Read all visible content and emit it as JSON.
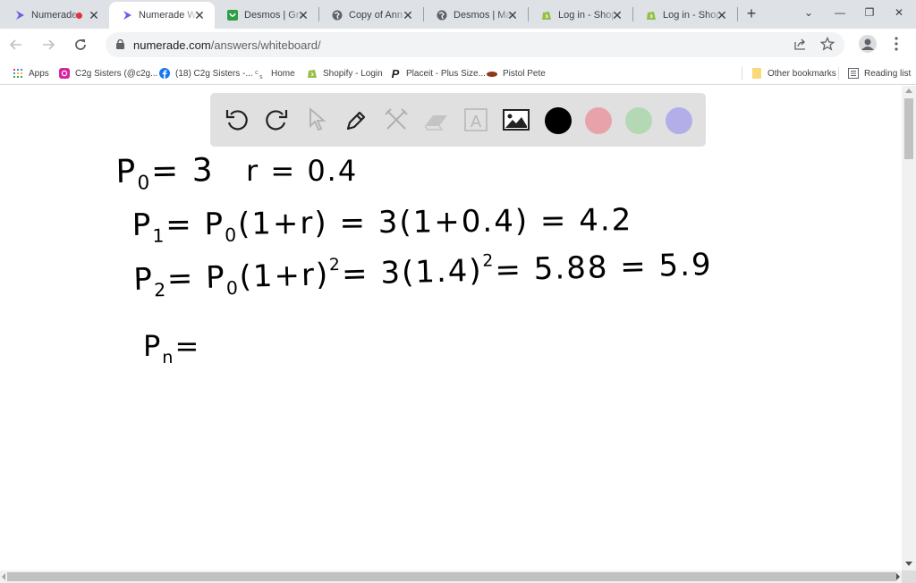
{
  "browser": {
    "tabs": [
      {
        "title": "Numerade",
        "favicon": "numerade-logo",
        "recording": true,
        "active": false
      },
      {
        "title": "Numerade Whiteboard",
        "favicon": "numerade-logo",
        "active": true
      },
      {
        "title": "Desmos | Graphing Calculator",
        "favicon": "desmos-logo",
        "active": false
      },
      {
        "title": "Copy of Ann X",
        "favicon": "globe-icon",
        "active": false
      },
      {
        "title": "Desmos | Matrix",
        "favicon": "globe-icon",
        "active": false
      },
      {
        "title": "Log in - Shopify",
        "favicon": "shopify-logo",
        "active": false
      },
      {
        "title": "Log in - Shopify",
        "favicon": "shopify-logo",
        "active": false
      }
    ],
    "new_tab_icon": "+",
    "window_controls": {
      "dropdown": "⌄",
      "minimize": "—",
      "restore": "❐",
      "close": "✕"
    },
    "address": {
      "domain": "numerade.com",
      "path": "/answers/whiteboard/"
    },
    "bookmarks": [
      {
        "label": "Apps",
        "icon": "apps-grid-icon"
      },
      {
        "label": "C2g Sisters (@c2g...",
        "icon": "instagram-icon"
      },
      {
        "label": "(18) C2g Sisters -...",
        "icon": "facebook-icon"
      },
      {
        "label": "Home",
        "icon": "home-link-icon"
      },
      {
        "label": "Shopify - Login",
        "icon": "shopify-icon"
      },
      {
        "label": "Placeit - Plus Size...",
        "icon": "placeit-icon"
      },
      {
        "label": "Pistol Pete",
        "icon": "pistol-pete-icon"
      }
    ],
    "other_bookmarks": "Other bookmarks",
    "reading_list": "Reading list"
  },
  "whiteboard": {
    "tools": [
      {
        "name": "undo",
        "enabled": true
      },
      {
        "name": "redo",
        "enabled": true
      },
      {
        "name": "select",
        "enabled": false
      },
      {
        "name": "pen",
        "enabled": true,
        "selected": true
      },
      {
        "name": "shapes",
        "enabled": false
      },
      {
        "name": "eraser",
        "enabled": false
      },
      {
        "name": "text",
        "enabled": false,
        "glyph": "A"
      },
      {
        "name": "image",
        "enabled": true
      }
    ],
    "colors": [
      "#000000",
      "#e8a3aa",
      "#b3d8b3",
      "#b3aee8"
    ],
    "handwriting": {
      "line1_a": {
        "base": "P",
        "sub": "0",
        "rest": "= 3"
      },
      "line1_b": "r = 0.4",
      "line2": {
        "base": "P",
        "sub": "1",
        "rest": "= P",
        "sub2": "0",
        "rest2": "(1+r) = 3(1+0.4) = 4.2"
      },
      "line3": {
        "base": "P",
        "sub": "2",
        "rest": "= P",
        "sub2": "0",
        "rest2": "(1+r)",
        "exp": "2",
        "rest3": "= 3(1.4)",
        "exp2": "2",
        "rest4": "= 5.88 = 5.9"
      },
      "line4": {
        "base": "P",
        "sub": "n",
        "rest": "="
      }
    }
  }
}
